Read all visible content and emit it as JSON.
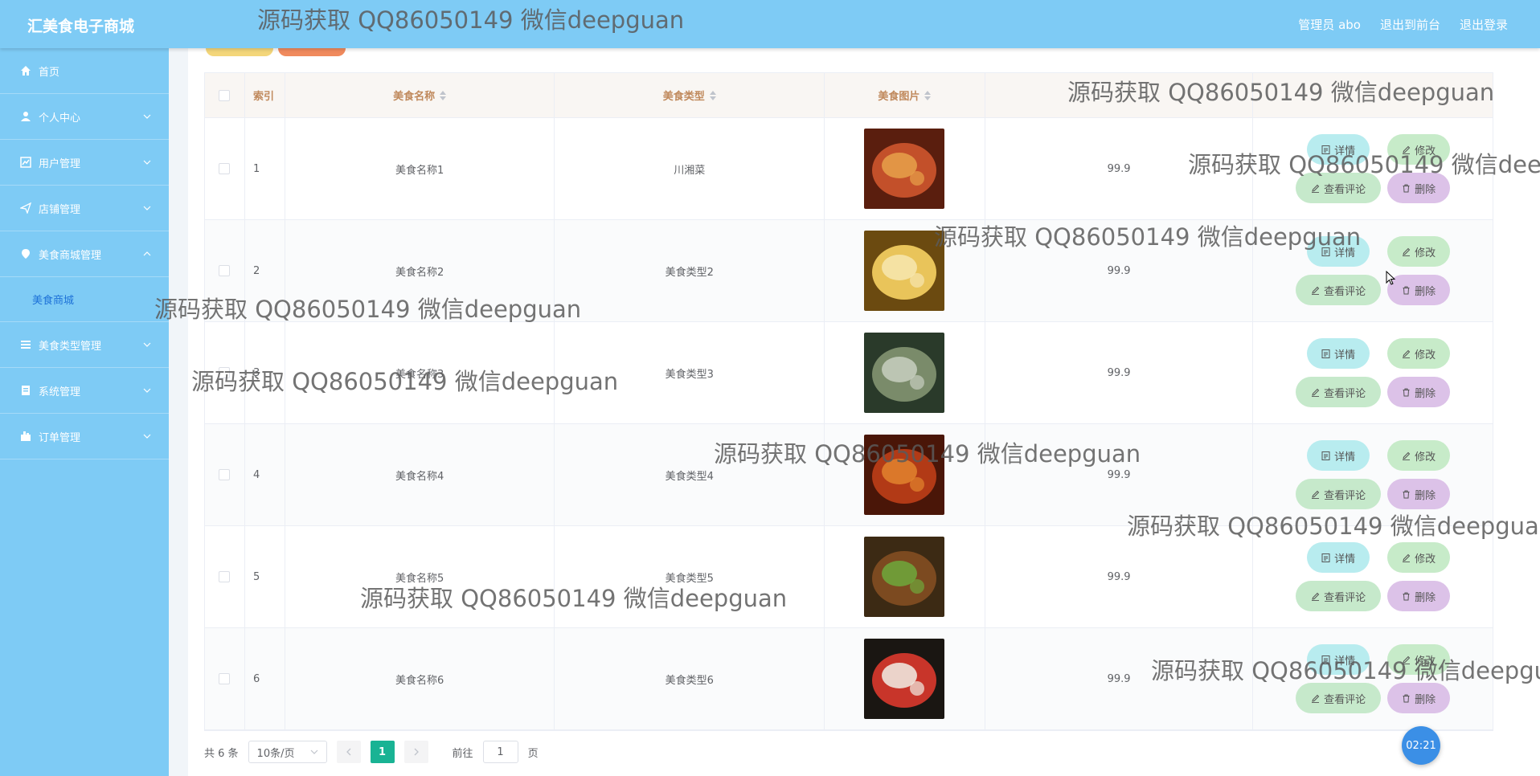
{
  "app": {
    "title": "汇美食电子商城"
  },
  "header": {
    "admin": "管理员 abo",
    "to_front": "退出到前台",
    "logout": "退出登录"
  },
  "sidebar": {
    "items": [
      {
        "label": "首页",
        "icon": "home-icon"
      },
      {
        "label": "个人中心",
        "icon": "user-icon"
      },
      {
        "label": "用户管理",
        "icon": "chart-icon"
      },
      {
        "label": "店铺管理",
        "icon": "send-icon"
      },
      {
        "label": "美食商城管理",
        "icon": "location-icon"
      },
      {
        "label": "美食类型管理",
        "icon": "list-icon"
      },
      {
        "label": "系统管理",
        "icon": "system-icon"
      },
      {
        "label": "订单管理",
        "icon": "order-icon"
      }
    ],
    "submenu": "美食商城"
  },
  "table": {
    "headers": [
      "索引",
      "美食名称",
      "美食类型",
      "美食图片",
      "价格",
      "操作"
    ],
    "rows": [
      {
        "index": "1",
        "name": "美食名称1",
        "type": "川湘菜",
        "price": "99.9"
      },
      {
        "index": "2",
        "name": "美食名称2",
        "type": "美食类型2",
        "price": "99.9"
      },
      {
        "index": "3",
        "name": "美食名称3",
        "type": "美食类型3",
        "price": "99.9"
      },
      {
        "index": "4",
        "name": "美食名称4",
        "type": "美食类型4",
        "price": "99.9"
      },
      {
        "index": "5",
        "name": "美食名称5",
        "type": "美食类型5",
        "price": "99.9"
      },
      {
        "index": "6",
        "name": "美食名称6",
        "type": "美食类型6",
        "price": "99.9"
      }
    ],
    "actions": {
      "detail": "详情",
      "edit": "修改",
      "review": "查看评论",
      "delete": "删除"
    }
  },
  "pagination": {
    "total": "共 6 条",
    "page_size": "10条/页",
    "current": "1",
    "goto_prefix": "前往",
    "goto_value": "1",
    "goto_suffix": "页"
  },
  "timer": "02:21",
  "watermark": "源码获取 QQ86050149 微信deepguan",
  "colors": {
    "primary": "#7ecbf5",
    "header_text": "#c0895c",
    "page_active": "#19b394",
    "detail_btn": "#b8ecef",
    "edit_btn": "#c7ebc9",
    "review_btn": "#c6e9cb",
    "delete_btn": "#dcc2e8"
  }
}
